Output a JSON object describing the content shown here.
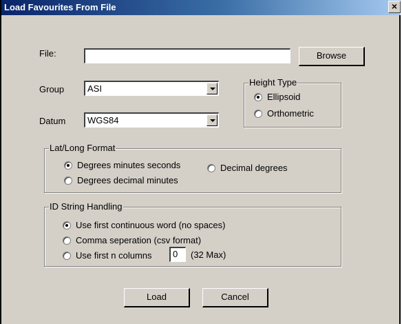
{
  "window": {
    "title": "Load Favourites From File",
    "close_glyph": "×"
  },
  "file": {
    "label": "File:",
    "value": "",
    "browse_label": "Browse"
  },
  "group": {
    "label": "Group",
    "value": "ASI"
  },
  "datum": {
    "label": "Datum",
    "value": "WGS84"
  },
  "height_type": {
    "legend": "Height Type",
    "options": [
      "Ellipsoid",
      "Orthometric"
    ],
    "selected": "Ellipsoid"
  },
  "latlong": {
    "legend": "Lat/Long Format",
    "options": [
      "Degrees minutes seconds",
      "Degrees decimal minutes",
      "Decimal degrees"
    ],
    "selected": "Degrees minutes seconds"
  },
  "idstring": {
    "legend": "ID String Handling",
    "options": [
      "Use first continuous word (no spaces)",
      "Comma seperation (csv format)",
      "Use first n columns"
    ],
    "selected": "Use first continuous word (no spaces)",
    "columns_value": "0",
    "columns_hint": "(32 Max)"
  },
  "actions": {
    "load_label": "Load",
    "cancel_label": "Cancel"
  }
}
